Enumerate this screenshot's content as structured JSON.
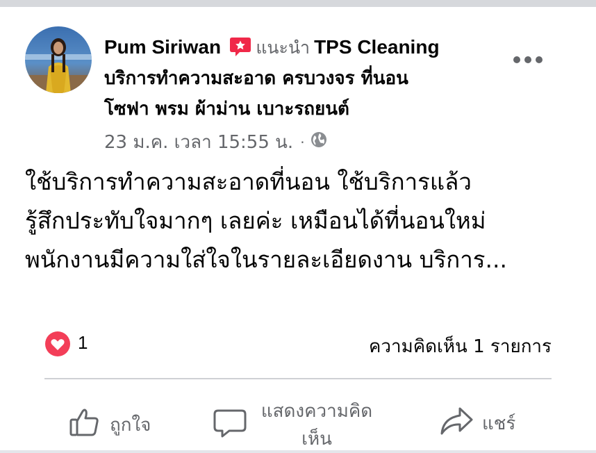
{
  "post": {
    "author": "Pum Siriwan",
    "recommend_verb": "แนะนำ",
    "page_name_part1": "TPS Cleaning",
    "page_name_line2": "บริการทำความสะอาด ครบวงจร ที่นอน",
    "page_name_line3": "โซฟา พรม ผ้าม่าน เบาะรถยนต์",
    "timestamp": "23 ม.ค. เวลา 15:55 น.",
    "separator": "·",
    "privacy_icon": "globe-icon",
    "body_lines": [
      "ใช้บริการทำความสะอาดที่นอน  ใช้บริการแล้ว",
      "รู้สึกประทับใจมากๆ เลยค่ะ เหมือนได้ที่นอนใหม่",
      "พนักงานมีความใส่ใจในรายละเอียดงาน บริการ..."
    ]
  },
  "stats": {
    "reaction_icon": "love-reaction-icon",
    "reaction_count": "1",
    "comment_count_text": "ความคิดเห็น 1 รายการ"
  },
  "actions": {
    "like_label": "ถูกใจ",
    "comment_label": "แสดงความคิดเห็น",
    "share_label": "แชร์"
  },
  "colors": {
    "text_primary": "#050505",
    "text_secondary": "#65676b",
    "recommend_badge": "#f02849",
    "love_reaction": "#f33e58",
    "divider": "#ced0d4"
  }
}
